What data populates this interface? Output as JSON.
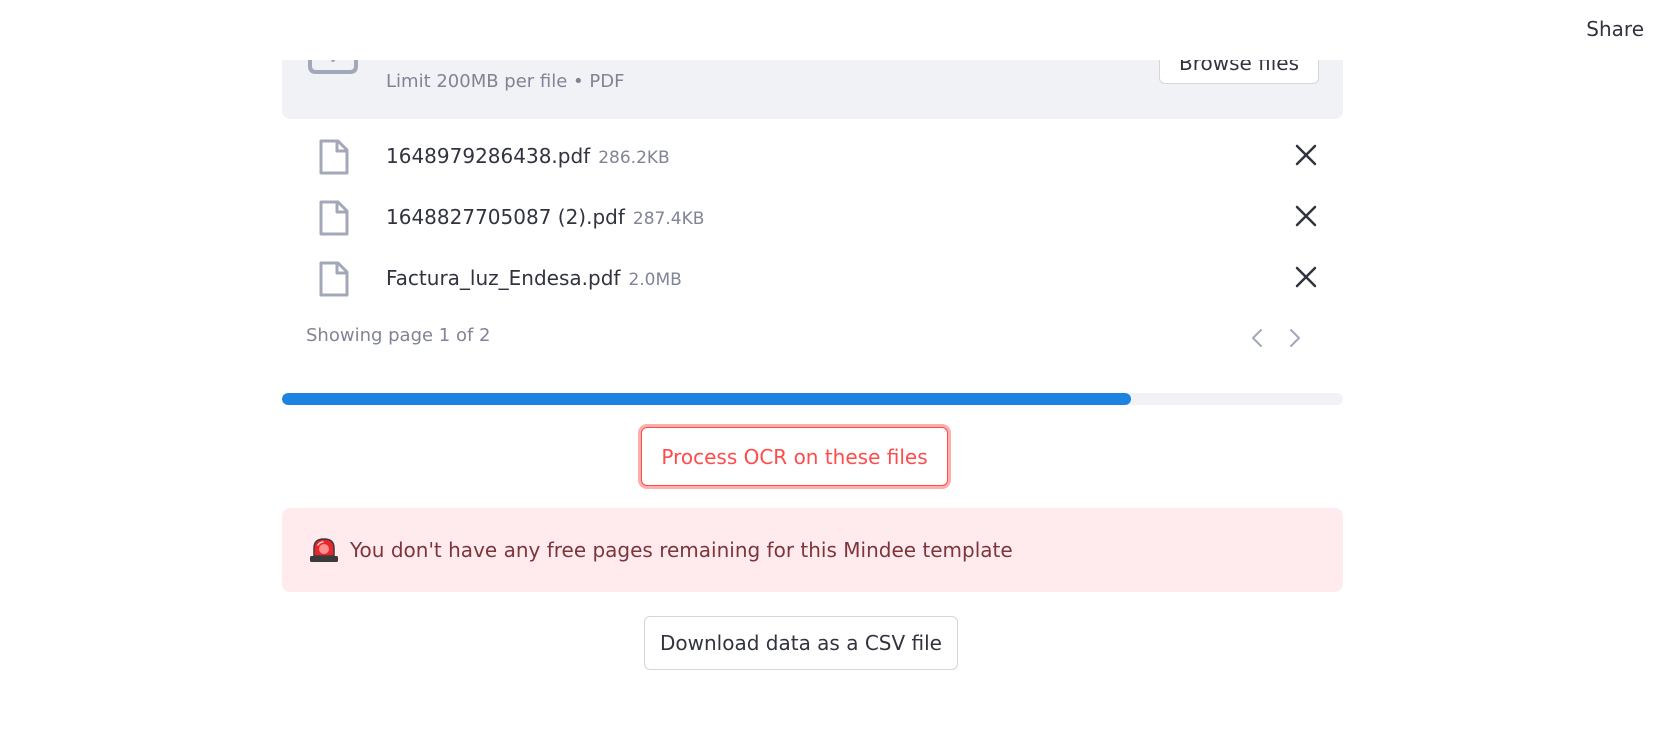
{
  "header": {
    "share_label": "Share"
  },
  "uploader": {
    "limit_text": "Limit 200MB per file • PDF",
    "browse_label": "Browse files"
  },
  "files": [
    {
      "name": "1648979286438.pdf",
      "size": "286.2KB"
    },
    {
      "name": "1648827705087 (2).pdf",
      "size": "287.4KB"
    },
    {
      "name": "Factura_luz_Endesa.pdf",
      "size": "2.0MB"
    }
  ],
  "pagination": {
    "text": "Showing page 1 of 2"
  },
  "progress": {
    "percent": 80,
    "color": "#1c83e1"
  },
  "actions": {
    "process_ocr_label": "Process OCR on these files",
    "download_csv_label": "Download data as a CSV file"
  },
  "alert": {
    "icon": "rotating-light-icon",
    "message": "You don't have any free pages remaining for this Mindee template"
  },
  "colors": {
    "primary": "#ff4b4b",
    "progress": "#1c83e1",
    "alert_bg": "#ffebee",
    "alert_text": "#7d353b"
  }
}
